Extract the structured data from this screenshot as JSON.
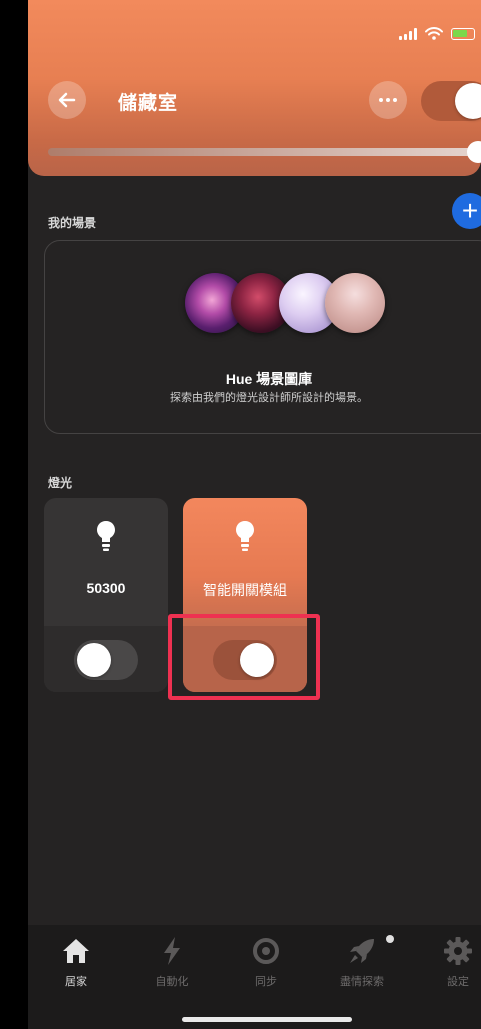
{
  "header": {
    "room_title": "儲藏室",
    "room_on": true,
    "brightness": 1.0
  },
  "scenes": {
    "section_label": "我的場景",
    "gallery_title": "Hue 場景圖庫",
    "gallery_subtitle": "探索由我們的燈光設計師所設計的場景。"
  },
  "lights": {
    "section_label": "燈光",
    "items": [
      {
        "name": "50300",
        "on": false
      },
      {
        "name": "智能開關模組",
        "on": true
      }
    ]
  },
  "nav": {
    "items": [
      {
        "label": "居家",
        "icon": "home-icon",
        "active": true
      },
      {
        "label": "自動化",
        "icon": "lightning-icon",
        "active": false
      },
      {
        "label": "同步",
        "icon": "sync-icon",
        "active": false
      },
      {
        "label": "盡情探索",
        "icon": "rocket-icon",
        "active": false
      },
      {
        "label": "設定",
        "icon": "gear-icon",
        "active": false
      }
    ]
  },
  "colors": {
    "header_accent": "#f28a5c",
    "add_button": "#1f6be0",
    "highlight": "#ee3151"
  }
}
